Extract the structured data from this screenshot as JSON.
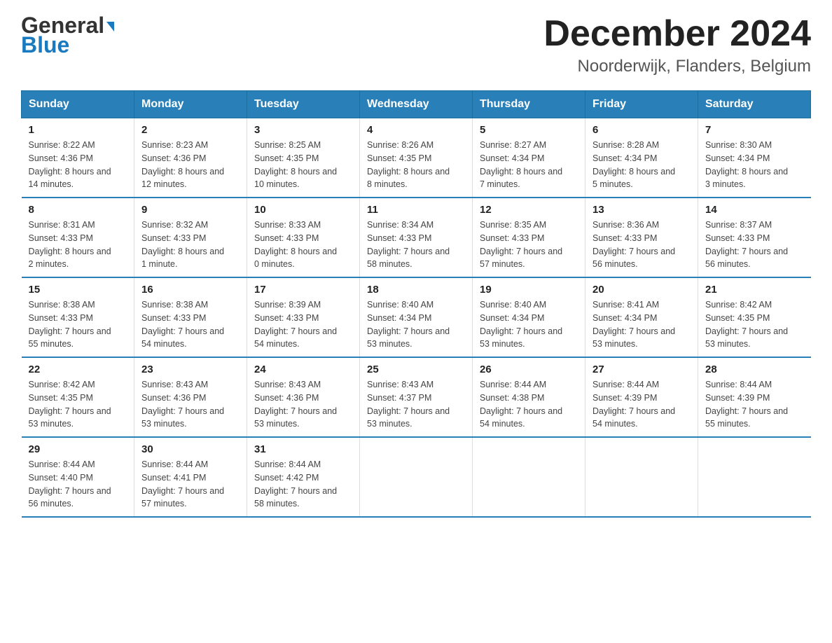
{
  "header": {
    "title": "December 2024",
    "subtitle": "Noorderwijk, Flanders, Belgium",
    "logo_general": "General",
    "logo_blue": "Blue"
  },
  "days_of_week": [
    "Sunday",
    "Monday",
    "Tuesday",
    "Wednesday",
    "Thursday",
    "Friday",
    "Saturday"
  ],
  "weeks": [
    [
      {
        "day": "1",
        "sunrise": "8:22 AM",
        "sunset": "4:36 PM",
        "daylight": "8 hours and 14 minutes."
      },
      {
        "day": "2",
        "sunrise": "8:23 AM",
        "sunset": "4:36 PM",
        "daylight": "8 hours and 12 minutes."
      },
      {
        "day": "3",
        "sunrise": "8:25 AM",
        "sunset": "4:35 PM",
        "daylight": "8 hours and 10 minutes."
      },
      {
        "day": "4",
        "sunrise": "8:26 AM",
        "sunset": "4:35 PM",
        "daylight": "8 hours and 8 minutes."
      },
      {
        "day": "5",
        "sunrise": "8:27 AM",
        "sunset": "4:34 PM",
        "daylight": "8 hours and 7 minutes."
      },
      {
        "day": "6",
        "sunrise": "8:28 AM",
        "sunset": "4:34 PM",
        "daylight": "8 hours and 5 minutes."
      },
      {
        "day": "7",
        "sunrise": "8:30 AM",
        "sunset": "4:34 PM",
        "daylight": "8 hours and 3 minutes."
      }
    ],
    [
      {
        "day": "8",
        "sunrise": "8:31 AM",
        "sunset": "4:33 PM",
        "daylight": "8 hours and 2 minutes."
      },
      {
        "day": "9",
        "sunrise": "8:32 AM",
        "sunset": "4:33 PM",
        "daylight": "8 hours and 1 minute."
      },
      {
        "day": "10",
        "sunrise": "8:33 AM",
        "sunset": "4:33 PM",
        "daylight": "8 hours and 0 minutes."
      },
      {
        "day": "11",
        "sunrise": "8:34 AM",
        "sunset": "4:33 PM",
        "daylight": "7 hours and 58 minutes."
      },
      {
        "day": "12",
        "sunrise": "8:35 AM",
        "sunset": "4:33 PM",
        "daylight": "7 hours and 57 minutes."
      },
      {
        "day": "13",
        "sunrise": "8:36 AM",
        "sunset": "4:33 PM",
        "daylight": "7 hours and 56 minutes."
      },
      {
        "day": "14",
        "sunrise": "8:37 AM",
        "sunset": "4:33 PM",
        "daylight": "7 hours and 56 minutes."
      }
    ],
    [
      {
        "day": "15",
        "sunrise": "8:38 AM",
        "sunset": "4:33 PM",
        "daylight": "7 hours and 55 minutes."
      },
      {
        "day": "16",
        "sunrise": "8:38 AM",
        "sunset": "4:33 PM",
        "daylight": "7 hours and 54 minutes."
      },
      {
        "day": "17",
        "sunrise": "8:39 AM",
        "sunset": "4:33 PM",
        "daylight": "7 hours and 54 minutes."
      },
      {
        "day": "18",
        "sunrise": "8:40 AM",
        "sunset": "4:34 PM",
        "daylight": "7 hours and 53 minutes."
      },
      {
        "day": "19",
        "sunrise": "8:40 AM",
        "sunset": "4:34 PM",
        "daylight": "7 hours and 53 minutes."
      },
      {
        "day": "20",
        "sunrise": "8:41 AM",
        "sunset": "4:34 PM",
        "daylight": "7 hours and 53 minutes."
      },
      {
        "day": "21",
        "sunrise": "8:42 AM",
        "sunset": "4:35 PM",
        "daylight": "7 hours and 53 minutes."
      }
    ],
    [
      {
        "day": "22",
        "sunrise": "8:42 AM",
        "sunset": "4:35 PM",
        "daylight": "7 hours and 53 minutes."
      },
      {
        "day": "23",
        "sunrise": "8:43 AM",
        "sunset": "4:36 PM",
        "daylight": "7 hours and 53 minutes."
      },
      {
        "day": "24",
        "sunrise": "8:43 AM",
        "sunset": "4:36 PM",
        "daylight": "7 hours and 53 minutes."
      },
      {
        "day": "25",
        "sunrise": "8:43 AM",
        "sunset": "4:37 PM",
        "daylight": "7 hours and 53 minutes."
      },
      {
        "day": "26",
        "sunrise": "8:44 AM",
        "sunset": "4:38 PM",
        "daylight": "7 hours and 54 minutes."
      },
      {
        "day": "27",
        "sunrise": "8:44 AM",
        "sunset": "4:39 PM",
        "daylight": "7 hours and 54 minutes."
      },
      {
        "day": "28",
        "sunrise": "8:44 AM",
        "sunset": "4:39 PM",
        "daylight": "7 hours and 55 minutes."
      }
    ],
    [
      {
        "day": "29",
        "sunrise": "8:44 AM",
        "sunset": "4:40 PM",
        "daylight": "7 hours and 56 minutes."
      },
      {
        "day": "30",
        "sunrise": "8:44 AM",
        "sunset": "4:41 PM",
        "daylight": "7 hours and 57 minutes."
      },
      {
        "day": "31",
        "sunrise": "8:44 AM",
        "sunset": "4:42 PM",
        "daylight": "7 hours and 58 minutes."
      },
      null,
      null,
      null,
      null
    ]
  ],
  "labels": {
    "sunrise": "Sunrise:",
    "sunset": "Sunset:",
    "daylight": "Daylight:"
  }
}
